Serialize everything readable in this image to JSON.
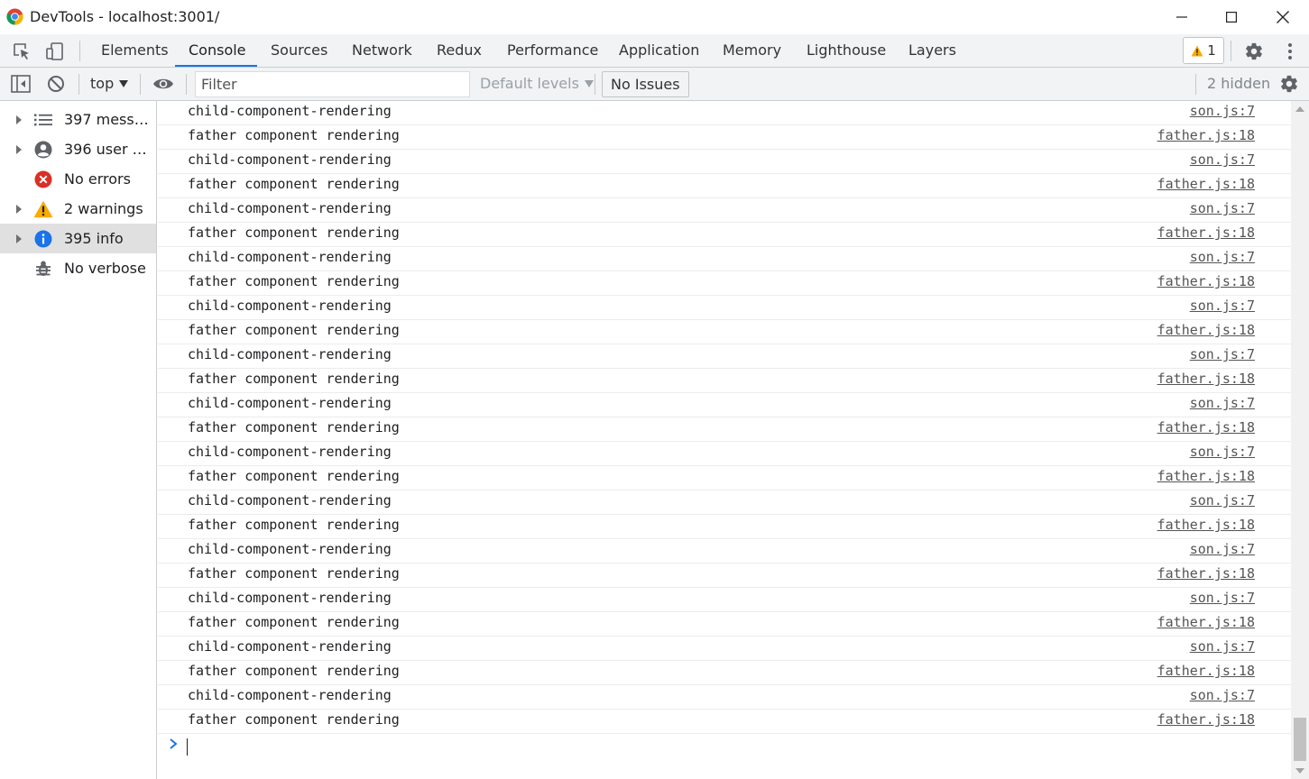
{
  "window": {
    "title": "DevTools - localhost:3001/"
  },
  "tabs": [
    {
      "label": "Elements"
    },
    {
      "label": "Console",
      "active": true
    },
    {
      "label": "Sources"
    },
    {
      "label": "Network"
    },
    {
      "label": "Redux"
    },
    {
      "label": "Performance"
    },
    {
      "label": "Application"
    },
    {
      "label": "Memory"
    },
    {
      "label": "Lighthouse"
    },
    {
      "label": "Layers"
    }
  ],
  "issues_badge": {
    "count": "1"
  },
  "toolbar": {
    "context": "top",
    "filter_placeholder": "Filter",
    "levels_label": "Default levels",
    "no_issues_label": "No Issues",
    "hidden_label": "2 hidden"
  },
  "sidebar": {
    "items": [
      {
        "label": "397 messag…",
        "icon": "list-icon",
        "expandable": true
      },
      {
        "label": "396 user me…",
        "icon": "user-icon",
        "expandable": true
      },
      {
        "label": "No errors",
        "icon": "error-icon",
        "expandable": false
      },
      {
        "label": "2 warnings",
        "icon": "warning-icon",
        "expandable": true
      },
      {
        "label": "395 info",
        "icon": "info-icon",
        "expandable": true,
        "selected": true
      },
      {
        "label": "No verbose",
        "icon": "bug-icon",
        "expandable": false
      }
    ]
  },
  "log": {
    "rows": [
      {
        "text": "child-component-rendering",
        "source": "son.js:7"
      },
      {
        "text": "father component rendering",
        "source": "father.js:18"
      },
      {
        "text": "child-component-rendering",
        "source": "son.js:7"
      },
      {
        "text": "father component rendering",
        "source": "father.js:18"
      },
      {
        "text": "child-component-rendering",
        "source": "son.js:7"
      },
      {
        "text": "father component rendering",
        "source": "father.js:18"
      },
      {
        "text": "child-component-rendering",
        "source": "son.js:7"
      },
      {
        "text": "father component rendering",
        "source": "father.js:18"
      },
      {
        "text": "child-component-rendering",
        "source": "son.js:7"
      },
      {
        "text": "father component rendering",
        "source": "father.js:18"
      },
      {
        "text": "child-component-rendering",
        "source": "son.js:7"
      },
      {
        "text": "father component rendering",
        "source": "father.js:18"
      },
      {
        "text": "child-component-rendering",
        "source": "son.js:7"
      },
      {
        "text": "father component rendering",
        "source": "father.js:18"
      },
      {
        "text": "child-component-rendering",
        "source": "son.js:7"
      },
      {
        "text": "father component rendering",
        "source": "father.js:18"
      },
      {
        "text": "child-component-rendering",
        "source": "son.js:7"
      },
      {
        "text": "father component rendering",
        "source": "father.js:18"
      },
      {
        "text": "child-component-rendering",
        "source": "son.js:7"
      },
      {
        "text": "father component rendering",
        "source": "father.js:18"
      },
      {
        "text": "child-component-rendering",
        "source": "son.js:7"
      },
      {
        "text": "father component rendering",
        "source": "father.js:18"
      },
      {
        "text": "child-component-rendering",
        "source": "son.js:7"
      },
      {
        "text": "father component rendering",
        "source": "father.js:18"
      },
      {
        "text": "child-component-rendering",
        "source": "son.js:7"
      },
      {
        "text": "father component rendering",
        "source": "father.js:18"
      }
    ]
  },
  "colors": {
    "accent": "#1a73e8",
    "error": "#d93025",
    "warning": "#f9ab00",
    "info": "#1a73e8"
  }
}
